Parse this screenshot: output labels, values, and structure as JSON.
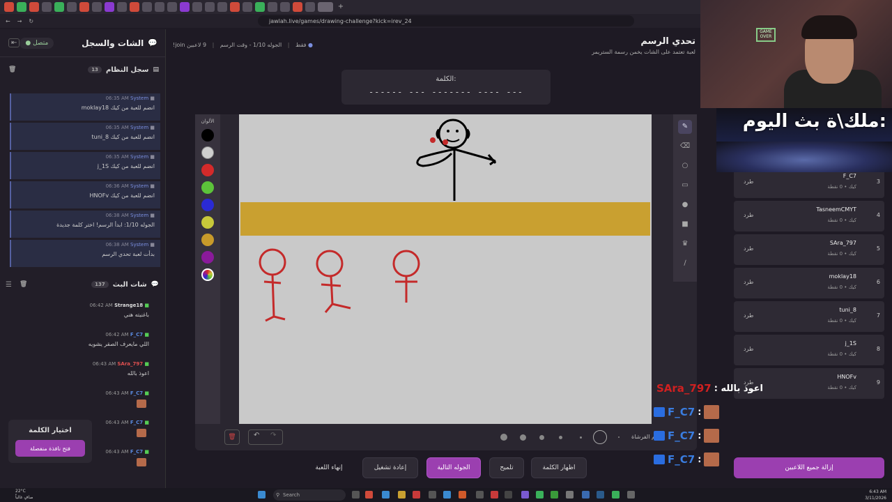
{
  "browser": {
    "url": "jawlah.live/games/drawing-challenge?kick=irev_24"
  },
  "sidebar": {
    "title": "الشات والسجل",
    "online_label": "متصل",
    "system_log": {
      "title": "سجل النظام",
      "count": "13",
      "messages": [
        {
          "sender": "System",
          "time": "06:35 AM",
          "text": "moklay18 انضم للعبة من كيك"
        },
        {
          "sender": "System",
          "time": "06:35 AM",
          "text": "tuni_8 انضم للعبة من كيك"
        },
        {
          "sender": "System",
          "time": "06:35 AM",
          "text": "j_1S انضم للعبة من كيك"
        },
        {
          "sender": "System",
          "time": "06:36 AM",
          "text": "HNOFv انضم للعبة من كيك"
        },
        {
          "sender": "System",
          "time": "06:38 AM",
          "text": "الجوله 1/10: ابدأ الرسم! اختر كلمة جديدة"
        },
        {
          "sender": "System",
          "time": "06:38 AM",
          "text": "بدأت لعبة تحدي الرسم"
        }
      ]
    },
    "stream_chat": {
      "title": "شات البث",
      "count": "137",
      "messages": [
        {
          "user": "Strange18",
          "time": "06:42 AM",
          "text": "باغنيته هني"
        },
        {
          "user": "F_C7",
          "time": "06:42 AM",
          "text": "اللي مايعرف الصقر يشويه"
        },
        {
          "user": "SAra_797",
          "time": "06:43 AM",
          "text": "اعوذ بالله"
        },
        {
          "user": "F_C7",
          "time": "06:43 AM",
          "text": ""
        },
        {
          "user": "F_C7",
          "time": "06:43 AM",
          "text": ""
        },
        {
          "user": "F_C7",
          "time": "06:43 AM",
          "text": ""
        }
      ]
    },
    "choose_word": {
      "title": "اختيار الكلمة",
      "button": "فتح نافذة منفصلة"
    }
  },
  "game": {
    "title": "تحدي الرسم",
    "subtitle": "لعبة تعتمد على الشات يخمن رسمة الستريمر",
    "players_count": "9 لاعبين",
    "round_info": "الجوله 1/10 - وقت الرسم",
    "join_note": "!join فقط",
    "word_label": "الكلمة:",
    "word_dashes": "------  ---  -------  ----  ---",
    "palette_label": "الألوان",
    "palette_colors": [
      "#000000",
      "#cfcfcf",
      "#d42a2a",
      "#5cc33a",
      "#2a2ad4",
      "#c8c83a",
      "#c89a2a",
      "#8a1a9a"
    ],
    "brush_label": "حجم الفرشاة:",
    "tools": [
      "pencil-icon",
      "eraser-icon",
      "circle-icon",
      "rectangle-icon",
      "fill-dot-icon",
      "square-fill-icon",
      "bucket-icon",
      "line-icon"
    ]
  },
  "actions": {
    "show_word": "اظهار الكلمة",
    "hint": "تلميح",
    "next_round": "الجوله التالية",
    "restart": "إعادة تشغيل",
    "end_game": "إنهاء اللعبة"
  },
  "players": [
    {
      "rank": "3",
      "name": "F_C7",
      "sub": "كيك • 0 نقطة",
      "kick": "طرد"
    },
    {
      "rank": "4",
      "name": "TasneemCMYT",
      "sub": "كيك • 0 نقطة",
      "kick": "طرد"
    },
    {
      "rank": "5",
      "name": "SAra_797",
      "sub": "كيك • 0 نقطة",
      "kick": "طرد"
    },
    {
      "rank": "6",
      "name": "moklay18",
      "sub": "كيك • 0 نقطة",
      "kick": "طرد"
    },
    {
      "rank": "7",
      "name": "tuni_8",
      "sub": "كيك • 0 نقطة",
      "kick": "طرد"
    },
    {
      "rank": "8",
      "name": "j_1S",
      "sub": "كيك • 0 نقطة",
      "kick": "طرد"
    },
    {
      "rank": "9",
      "name": "HNOFv",
      "sub": "كيك • 0 نقطة",
      "kick": "طرد"
    }
  ],
  "remove_all": "إزالة جميع اللاعبين",
  "overlay": {
    "banner_text": "ملك\\ة بث اليوم:",
    "chat": [
      {
        "name": "SAra_797",
        "msg": ": اعوذ بالله"
      },
      {
        "name": "F_C7",
        "msg": ":"
      },
      {
        "name": "F_C7",
        "msg": ":"
      },
      {
        "name": "F_C7",
        "msg": ":"
      }
    ]
  },
  "taskbar": {
    "weather_temp": "22°C",
    "weather_desc": "صافٍ غالباً",
    "search": "Search",
    "time": "6:43 AM",
    "date": "3/11/2026"
  }
}
